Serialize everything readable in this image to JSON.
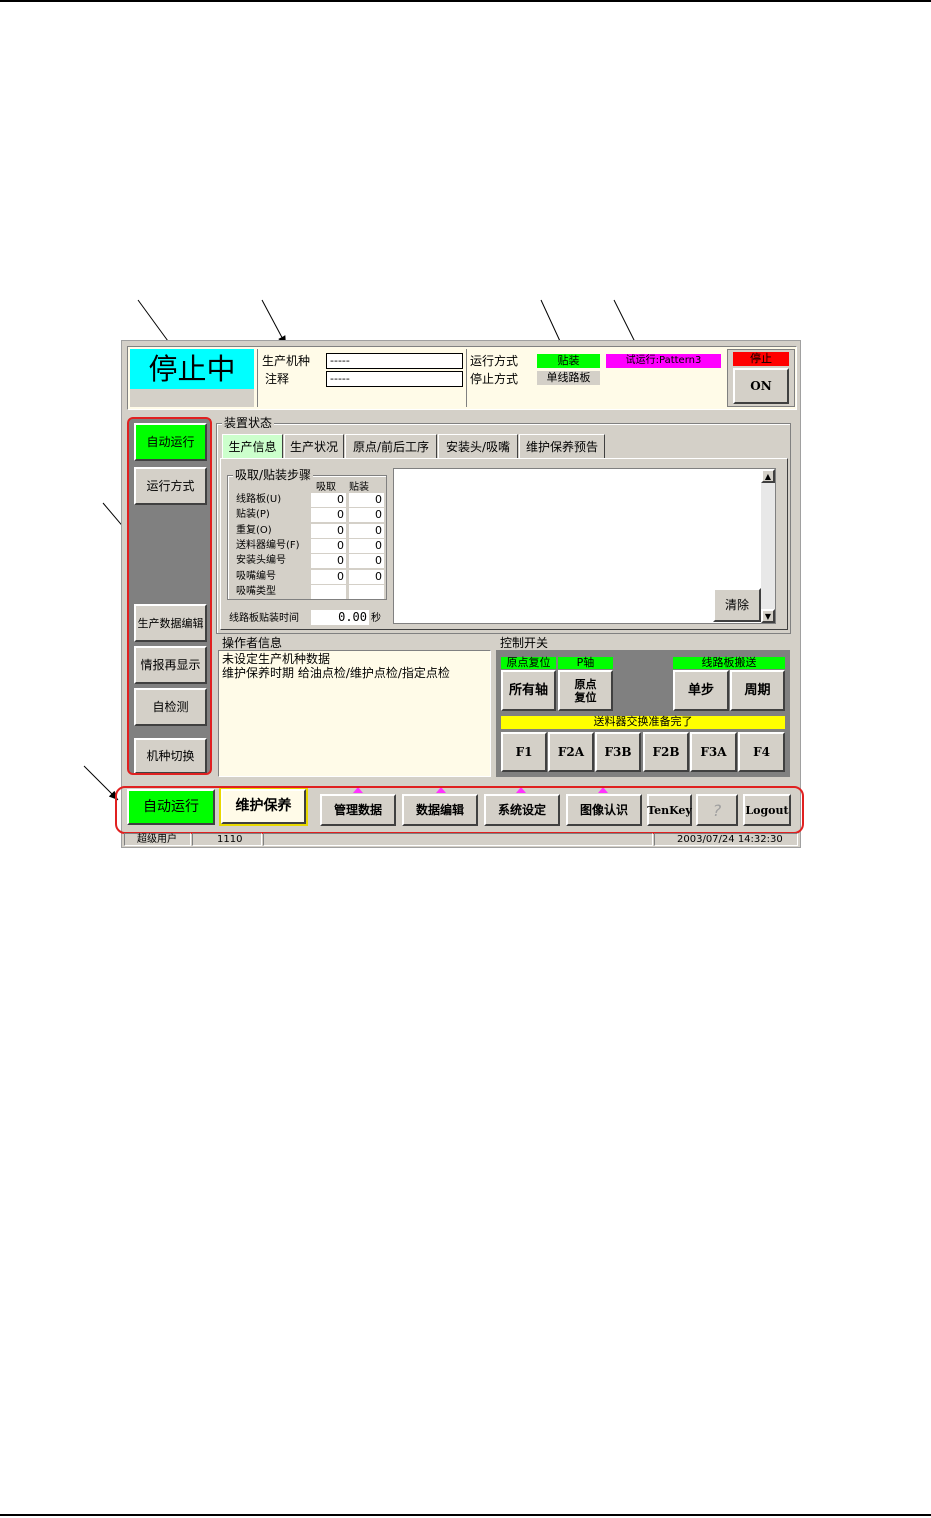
{
  "status": {
    "state": "停止中"
  },
  "production": {
    "model_label": "生产机种",
    "model_value": "-----",
    "note_label": "注释",
    "note_value": "-----"
  },
  "run": {
    "mode_label": "运行方式",
    "mode_value": "贴装",
    "stop_label": "停止方式",
    "stop_value": "单线路板",
    "trial_value": "试运行:Pattern3"
  },
  "stop_panel": {
    "header": "停止",
    "button": "ON"
  },
  "left_menu": {
    "auto_run": "自动运行",
    "run_mode": "运行方式",
    "prod_edit": "生产数据编辑",
    "info_redisplay": "情报再显示",
    "self_check": "自检测",
    "model_switch": "机种切换"
  },
  "device_status": {
    "title": "装置状态",
    "tabs": [
      "生产信息",
      "生产状况",
      "原点/前后工序",
      "安装头/吸嘴",
      "维护保养预告"
    ],
    "steps_title": "吸取/贴装步骤",
    "col_pick": "吸取",
    "col_place": "贴装",
    "rows": [
      {
        "label": "线路板(U)",
        "pick": "0",
        "place": "0"
      },
      {
        "label": "贴装(P)",
        "pick": "0",
        "place": "0"
      },
      {
        "label": "重复(O)",
        "pick": "0",
        "place": "0"
      },
      {
        "label": "送料器编号(F)",
        "pick": "0",
        "place": "0"
      },
      {
        "label": "安装头编号",
        "pick": "0",
        "place": "0"
      },
      {
        "label": "吸嘴编号",
        "pick": "0",
        "place": "0"
      },
      {
        "label": "吸嘴类型",
        "pick": "",
        "place": ""
      }
    ],
    "time_label": "线路板贴装时间",
    "time_value": "0.00",
    "time_unit": "秒",
    "clear_button": "清除"
  },
  "operator_info": {
    "title": "操作者信息",
    "line1": "未设定生产机种数据",
    "line2": "维护保养时期 给油点检/维护点检/指定点检"
  },
  "control": {
    "title": "控制开关",
    "origin_reset": "原点复位",
    "p_axis": "P轴",
    "board_transport": "线路板搬送",
    "all_axes": "所有轴",
    "origin_reset_btn": "原点复位",
    "step": "单步",
    "cycle": "周期",
    "feeder_ready": "送料器交换准备完了",
    "fkeys": [
      "F1",
      "F2A",
      "F3B",
      "F2B",
      "F3A",
      "F4"
    ]
  },
  "bottom_bar": {
    "auto_run": "自动运行",
    "maintenance": "维护保养",
    "manage_data": "管理数据",
    "data_edit": "数据编辑",
    "system_settings": "系统设定",
    "image_recognition": "图像认识",
    "tenkey": "TenKey",
    "help": "?",
    "logout": "Logout"
  },
  "statusbar": {
    "user": "超级用户",
    "code": "1110",
    "datetime": "2003/07/24 14:32:30"
  },
  "colors": {
    "green": "#00ff00",
    "cyan": "#00ffff",
    "magenta": "#ff00ff",
    "red": "#ff0000",
    "yellow": "#ffff00",
    "panel": "#d4d0c8",
    "cream": "#fffbe8",
    "highlight": "#e02020"
  }
}
